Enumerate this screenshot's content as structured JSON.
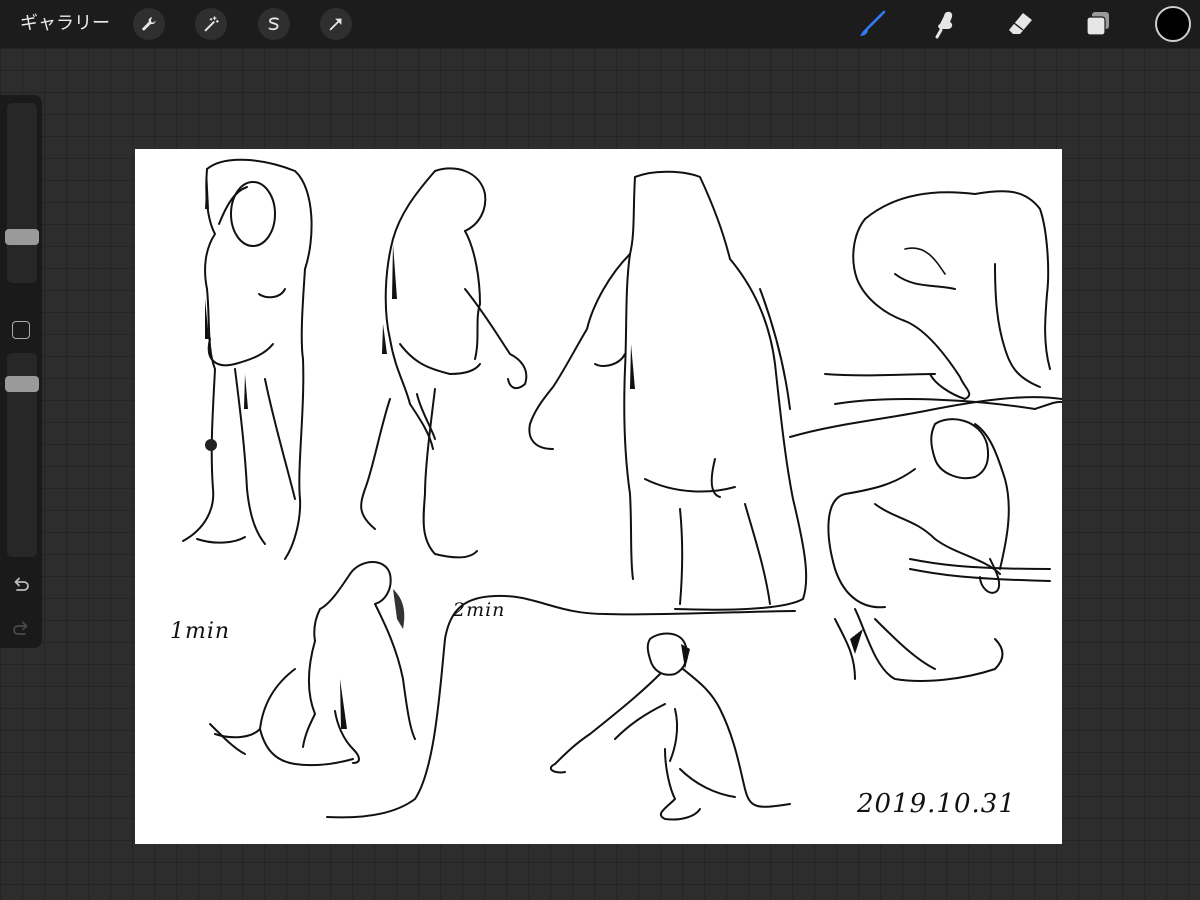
{
  "toolbar": {
    "gallery_label": "ギャラリー",
    "left_tools": [
      {
        "name": "actions",
        "icon": "wrench-icon"
      },
      {
        "name": "adjustments",
        "icon": "magic-wand-icon"
      },
      {
        "name": "selection",
        "icon": "selection-s-icon"
      },
      {
        "name": "transform",
        "icon": "arrow-cursor-icon"
      }
    ],
    "right_tools": [
      {
        "name": "brush",
        "icon": "brush-icon",
        "active": true
      },
      {
        "name": "smudge",
        "icon": "smudge-finger-icon",
        "active": false
      },
      {
        "name": "eraser",
        "icon": "eraser-icon",
        "active": false
      },
      {
        "name": "layers",
        "icon": "layers-icon",
        "active": false
      }
    ],
    "active_tool_color": "#2f7cf6",
    "current_color": "#000000"
  },
  "sidebar": {
    "brush_size_level": 0.28,
    "opacity_level": 0.12,
    "modify_icon": "square-icon",
    "undo_icon": "undo-icon",
    "redo_icon": "redo-icon"
  },
  "canvas": {
    "background": "#ffffff",
    "annotations": {
      "one_min": "1min",
      "two_min": "2min",
      "date": "2019.10.31"
    }
  }
}
